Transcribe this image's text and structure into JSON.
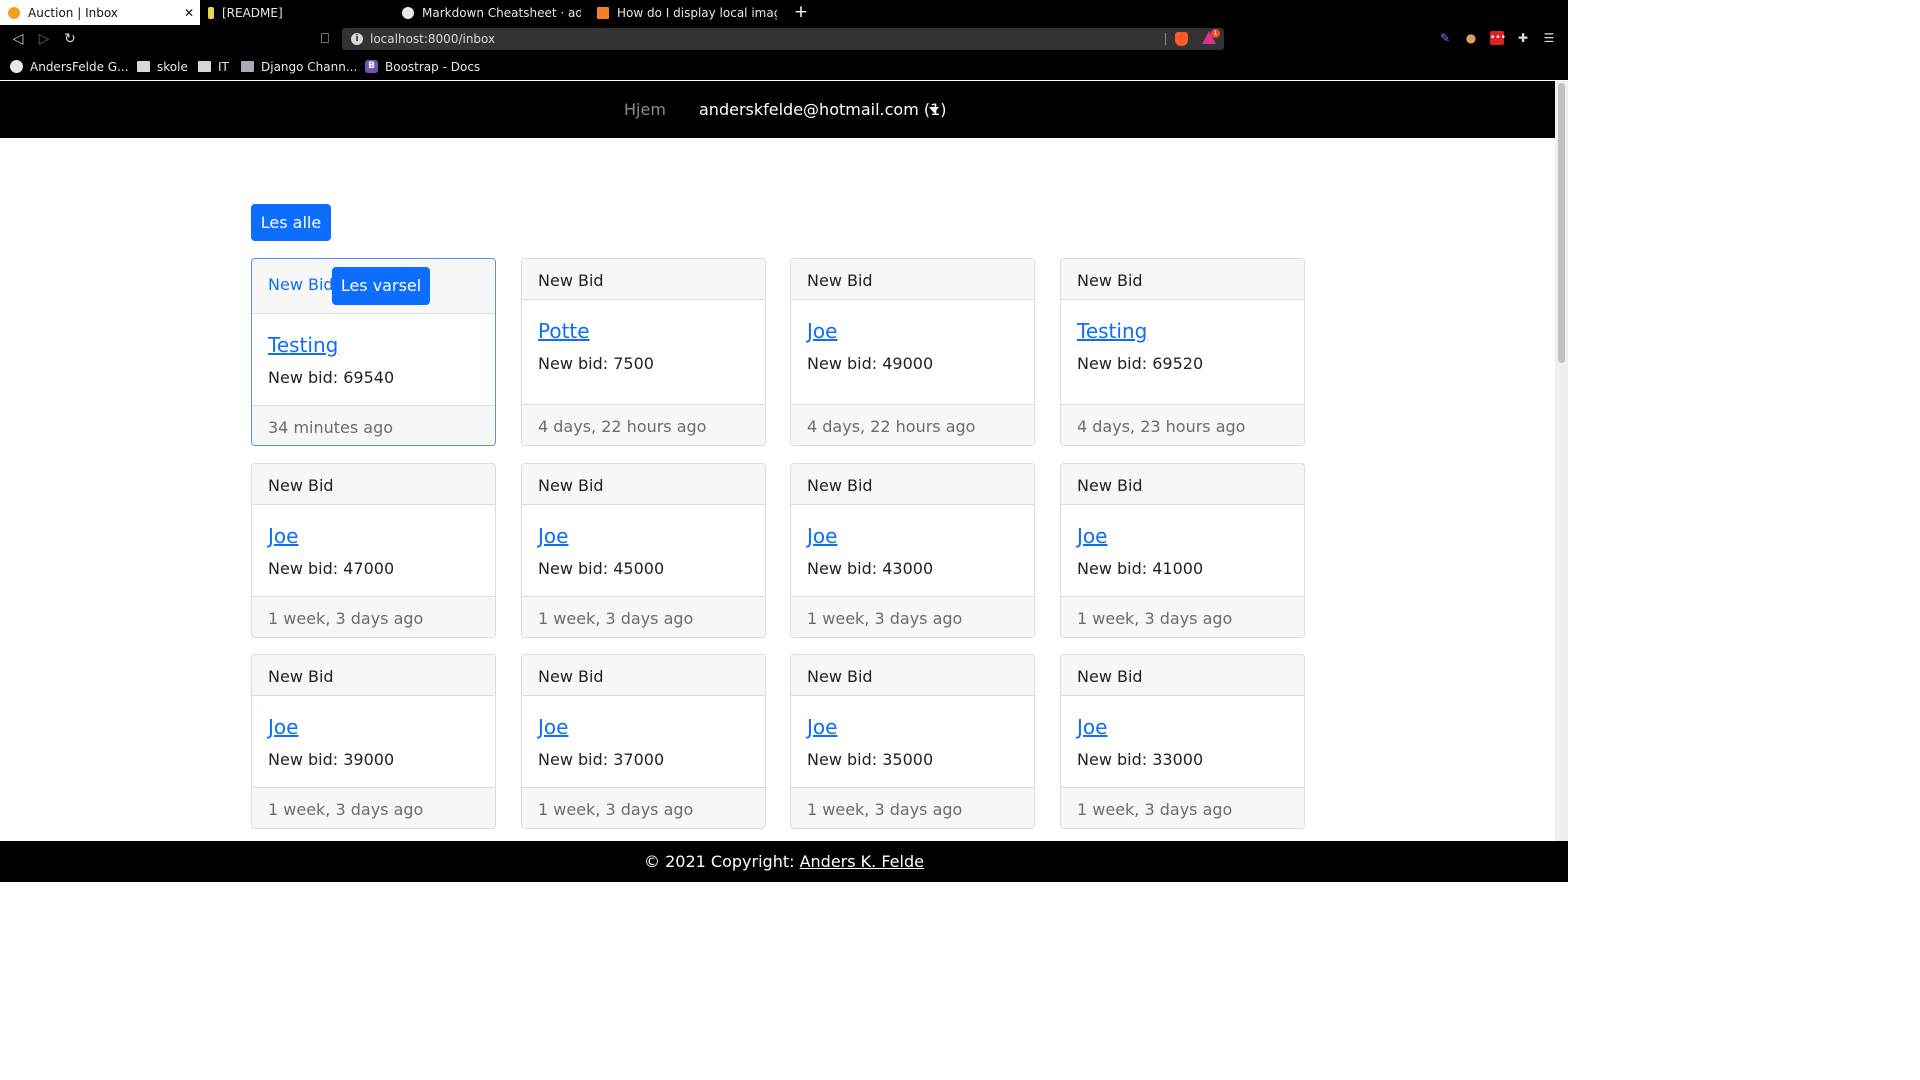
{
  "browser": {
    "tabs": [
      {
        "label": "Auction | Inbox",
        "active": true,
        "favicon_color": "#f0a020"
      },
      {
        "label": "[README]",
        "active": false,
        "favicon_color": "#e6d84a"
      },
      {
        "label": "Markdown Cheatsheet · adam",
        "active": false,
        "favicon_color": "#e8e8e8"
      },
      {
        "label": "How do I display local image i",
        "active": false,
        "favicon_color": "#f48024"
      }
    ],
    "url": "localhost:8000/inbox",
    "bat_badge": "1",
    "bookmarks": [
      {
        "label": "AndersFelde G...",
        "icon": "github-icon"
      },
      {
        "label": "skole",
        "icon": "folder-icon"
      },
      {
        "label": "IT",
        "icon": "folder-icon"
      },
      {
        "label": "Django Chann...",
        "icon": "django-icon"
      },
      {
        "label": "Boostrap - Docs",
        "icon": "bootstrap-icon"
      }
    ]
  },
  "site": {
    "nav": {
      "home": "Hjem",
      "user": "anderskfelde@hotmail.com (1)"
    },
    "read_all": "Les alle",
    "read_one": "Les varsel",
    "cards": [
      {
        "header": "New Bid",
        "title": "Testing",
        "bid": "New bid: 69540",
        "time": "34 minutes ago",
        "unread": true
      },
      {
        "header": "New Bid",
        "title": "Potte",
        "bid": "New bid: 7500",
        "time": "4 days, 22 hours ago"
      },
      {
        "header": "New Bid",
        "title": "Joe",
        "bid": "New bid: 49000",
        "time": "4 days, 22 hours ago"
      },
      {
        "header": "New Bid",
        "title": "Testing",
        "bid": "New bid: 69520",
        "time": "4 days, 23 hours ago"
      },
      {
        "header": "New Bid",
        "title": "Joe",
        "bid": "New bid: 47000",
        "time": "1 week, 3 days ago"
      },
      {
        "header": "New Bid",
        "title": "Joe",
        "bid": "New bid: 45000",
        "time": "1 week, 3 days ago"
      },
      {
        "header": "New Bid",
        "title": "Joe",
        "bid": "New bid: 43000",
        "time": "1 week, 3 days ago"
      },
      {
        "header": "New Bid",
        "title": "Joe",
        "bid": "New bid: 41000",
        "time": "1 week, 3 days ago"
      },
      {
        "header": "New Bid",
        "title": "Joe",
        "bid": "New bid: 39000",
        "time": "1 week, 3 days ago"
      },
      {
        "header": "New Bid",
        "title": "Joe",
        "bid": "New bid: 37000",
        "time": "1 week, 3 days ago"
      },
      {
        "header": "New Bid",
        "title": "Joe",
        "bid": "New bid: 35000",
        "time": "1 week, 3 days ago"
      },
      {
        "header": "New Bid",
        "title": "Joe",
        "bid": "New bid: 33000",
        "time": "1 week, 3 days ago"
      }
    ],
    "footer": {
      "prefix": "© 2021 Copyright: ",
      "author": "Anders K. Felde"
    }
  }
}
